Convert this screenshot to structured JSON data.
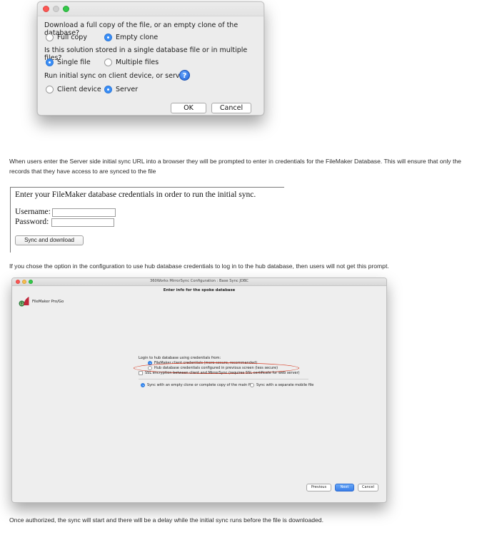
{
  "dialog": {
    "question1": "Download a full copy of the file, or an empty clone of the database?",
    "q1_options": [
      "Full copy",
      "Empty clone"
    ],
    "q1_selected": "Empty clone",
    "question2": "Is this solution stored in a single database file or in multiple files?",
    "q2_options": [
      "Single file",
      "Multiple files"
    ],
    "q2_selected": "Single file",
    "question3": "Run initial sync on client device, or server?",
    "help_glyph": "?",
    "q3_options": [
      "Client device",
      "Server"
    ],
    "q3_selected": "Server",
    "ok_label": "OK",
    "cancel_label": "Cancel"
  },
  "paragraph1": "When users enter the Server side initial sync URL into a browser they will be prompted to enter in credentials for the FileMaker Database. This will ensure that only the records that they have access to are synced to the file",
  "credentials": {
    "heading": "Enter your FileMaker database credentials in order to run the initial sync.",
    "username_label": "Username:",
    "password_label": "Password:",
    "button_label": "Sync and download"
  },
  "paragraph2": "If you chose the option in the configuration to use hub database credentials to log in to the hub database, then users will not get this prompt.",
  "window": {
    "title": "360Works MirrorSync Configuration : Base Sync JDBC",
    "subtitle": "Enter info for the spoke database",
    "logo_label": "FileMaker Pro/Go",
    "login_heading": "Login to hub database using credentials from:",
    "login_options": [
      "FileMaker client credentials (more secure, recommended)",
      "Hub database credentials configured in previous screen (less secure)"
    ],
    "ssl_label": "SSL encryption between client and MirrorSync (requires SSL certificate for web server)",
    "sync_options": [
      "Sync with an empty clone or complete copy of the main file",
      "Sync with a separate mobile file"
    ],
    "previous_label": "Previous",
    "next_label": "Next",
    "cancel_label": "Cancel",
    "highlight_color": "#d9432c"
  },
  "paragraph3": "Once authorized, the sync will start and there will be a delay while the initial sync runs before the file is downloaded."
}
